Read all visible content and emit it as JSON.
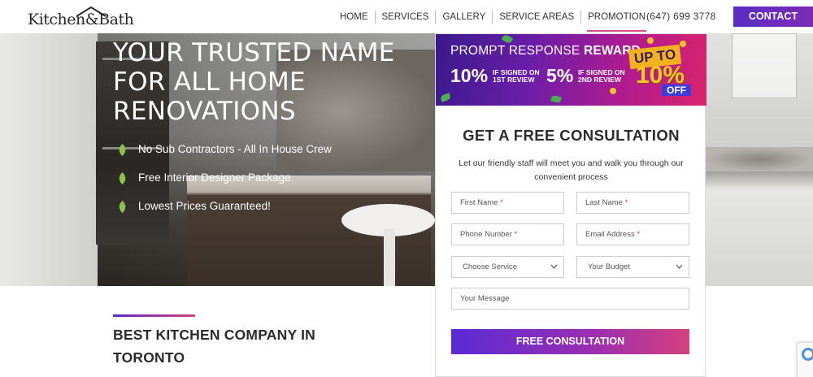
{
  "header": {
    "logo_text": "Kitchen&Bath",
    "nav": [
      {
        "label": "HOME",
        "active": false
      },
      {
        "label": "SERVICES",
        "active": false
      },
      {
        "label": "GALLERY",
        "active": false
      },
      {
        "label": "SERVICE AREAS",
        "active": false
      },
      {
        "label": "PROMOTION",
        "active": true
      }
    ],
    "phone": "(647) 699 3778",
    "contact_label": "CONTACT"
  },
  "hero": {
    "title": "YOUR TRUSTED NAME FOR ALL HOME RENOVATIONS",
    "bullets": [
      "No Sub Contractors - All In House Crew",
      "Free Interior Designer Package",
      "Lowest Prices Guaranteed!"
    ],
    "bullet_icon": "leaf-icon"
  },
  "promo": {
    "heading_prefix": "PROMPT RESPONSE ",
    "heading_bold": "REWARD",
    "offer1_pct": "10%",
    "offer1_line1": "IF SIGNED ON",
    "offer1_line2": "1ST REVIEW",
    "offer2_pct": "5%",
    "offer2_line1": "IF SIGNED ON",
    "offer2_line2": "2ND REVIEW",
    "badge_top": "UP TO",
    "badge_big": "10%",
    "badge_off": "OFF"
  },
  "form": {
    "title": "GET A FREE CONSULTATION",
    "subtitle": "Let our friendly staff will meet you and walk you through our convenient process",
    "first_name": "First Name",
    "last_name": "Last Name",
    "phone": "Phone Number",
    "email": "Email Address",
    "required_mark": "*",
    "service_select": "Choose Service",
    "budget_select": "Your Budget",
    "message": "Your Message",
    "submit_label": "FREE CONSULTATION"
  },
  "section": {
    "heading": "BEST KITCHEN COMPANY IN TORONTO"
  },
  "colors": {
    "brand_purple": "#5b2bc4",
    "brand_pink": "#d6407f",
    "leaf_green": "#8bc34a"
  }
}
